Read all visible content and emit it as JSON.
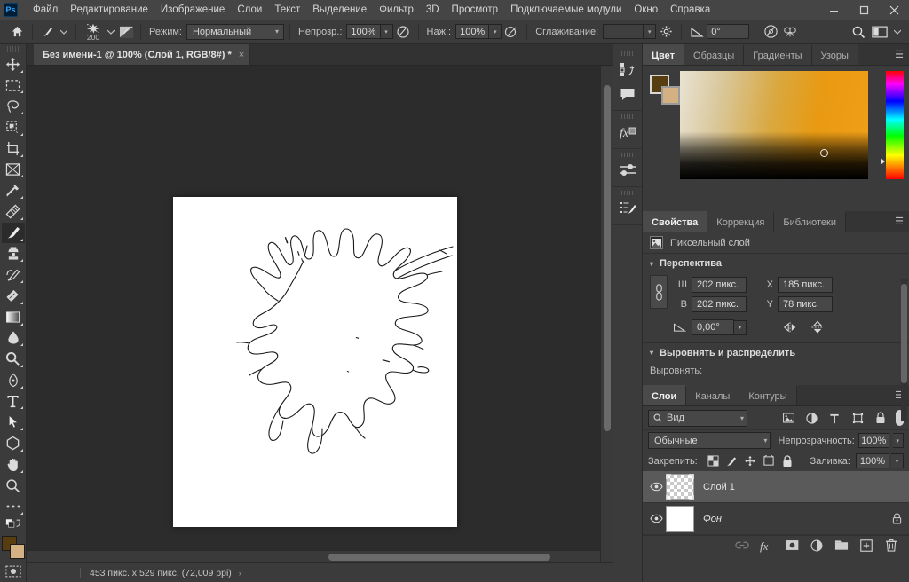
{
  "app": {
    "logo_text": "Ps",
    "window_controls": [
      "minimize",
      "maximize",
      "close"
    ]
  },
  "menubar": {
    "items": [
      {
        "label": "Файл",
        "name": "menu-file"
      },
      {
        "label": "Редактирование",
        "name": "menu-edit"
      },
      {
        "label": "Изображение",
        "name": "menu-image"
      },
      {
        "label": "Слои",
        "name": "menu-layers"
      },
      {
        "label": "Текст",
        "name": "menu-text"
      },
      {
        "label": "Выделение",
        "name": "menu-select"
      },
      {
        "label": "Фильтр",
        "name": "menu-filter"
      },
      {
        "label": "3D",
        "name": "menu-3d"
      },
      {
        "label": "Просмотр",
        "name": "menu-view"
      },
      {
        "label": "Подключаемые модули",
        "name": "menu-plugins"
      },
      {
        "label": "Окно",
        "name": "menu-window"
      },
      {
        "label": "Справка",
        "name": "menu-help"
      }
    ]
  },
  "options_bar": {
    "brush_size": "200",
    "mode_label": "Режим:",
    "mode_value": "Нормальный",
    "opacity_label": "Непрозр.:",
    "opacity_value": "100%",
    "flow_label": "Наж.:",
    "flow_value": "100%",
    "smoothing_label": "Сглаживание:",
    "angle_value": "0°"
  },
  "toolbar": {
    "tools": [
      {
        "name": "move-tool",
        "title": "Перемещение"
      },
      {
        "name": "marquee-tool",
        "title": "Прямоугольная область"
      },
      {
        "name": "lasso-tool",
        "title": "Лассо"
      },
      {
        "name": "quick-selection-tool",
        "title": "Быстрое выделение"
      },
      {
        "name": "crop-tool",
        "title": "Рамка"
      },
      {
        "name": "frame-tool",
        "title": "Кадр"
      },
      {
        "name": "eyedropper-tool",
        "title": "Пипетка"
      },
      {
        "name": "healing-brush-tool",
        "title": "Восстанавливающая кисть"
      },
      {
        "name": "brush-tool",
        "title": "Кисть",
        "active": true
      },
      {
        "name": "clone-stamp-tool",
        "title": "Штамп"
      },
      {
        "name": "history-brush-tool",
        "title": "Архивная кисть"
      },
      {
        "name": "eraser-tool",
        "title": "Ластик"
      },
      {
        "name": "gradient-tool",
        "title": "Градиент"
      },
      {
        "name": "blur-tool",
        "title": "Размытие"
      },
      {
        "name": "dodge-tool",
        "title": "Осветлитель"
      },
      {
        "name": "pen-tool",
        "title": "Перо"
      },
      {
        "name": "type-tool",
        "title": "Горизонтальный текст"
      },
      {
        "name": "path-selection-tool",
        "title": "Выделение контура"
      },
      {
        "name": "shape-tool",
        "title": "Многоугольник"
      },
      {
        "name": "hand-tool",
        "title": "Рука"
      },
      {
        "name": "zoom-tool",
        "title": "Масштаб"
      },
      {
        "name": "more-tools",
        "title": "Изменить панель инструментов"
      }
    ],
    "foreground_color": "#573d0f",
    "background_color": "#d3b183"
  },
  "document": {
    "tab_title": "Без имени-1 @ 100% (Слой 1, RGB/8#) *",
    "tab_close": "×"
  },
  "status_bar": {
    "zoom": "",
    "dimensions": "453 пикс. x 529 пикс. (72,009 ppi)",
    "arrow": "›"
  },
  "icon_dock": {
    "items": [
      {
        "name": "history-icon"
      },
      {
        "name": "comments-icon"
      },
      {
        "name": "layer-styles-fx-icon"
      },
      {
        "name": "adjustments-icon"
      },
      {
        "name": "brush-settings-icon"
      }
    ]
  },
  "color_panel": {
    "tabs": [
      {
        "label": "Цвет",
        "name": "tab-color",
        "active": true
      },
      {
        "label": "Образцы",
        "name": "tab-swatches",
        "active": false
      },
      {
        "label": "Градиенты",
        "name": "tab-gradients",
        "active": false
      },
      {
        "label": "Узоры",
        "name": "tab-patterns",
        "active": false
      }
    ],
    "menu_glyph": "☰",
    "foreground_color": "#573d0f",
    "background_color": "#d3b183"
  },
  "properties_panel": {
    "tabs": [
      {
        "label": "Свойства",
        "name": "tab-properties",
        "active": true
      },
      {
        "label": "Коррекция",
        "name": "tab-adjustments",
        "active": false
      },
      {
        "label": "Библиотеки",
        "name": "tab-libraries",
        "active": false
      }
    ],
    "menu_glyph": "☰",
    "layer_kind": "Пиксельный слой",
    "perspective_title": "Перспектива",
    "width_label": "Ш",
    "width_value": "202 пикс.",
    "height_label": "В",
    "height_value": "202 пикс.",
    "x_label": "X",
    "x_value": "185 пикс.",
    "y_label": "Y",
    "y_value": "78 пикс.",
    "angle_value": "0,00°",
    "align_title": "Выровнять и распределить",
    "align_label": "Выровнять:"
  },
  "layers_panel": {
    "tabs": [
      {
        "label": "Слои",
        "name": "tab-layers",
        "active": true
      },
      {
        "label": "Каналы",
        "name": "tab-channels",
        "active": false
      },
      {
        "label": "Контуры",
        "name": "tab-paths",
        "active": false
      }
    ],
    "menu_glyph": "☰",
    "filter_value": "Вид",
    "filter_icons": [
      {
        "name": "filter-pixel-icon"
      },
      {
        "name": "filter-adjustment-icon"
      },
      {
        "name": "filter-type-icon"
      },
      {
        "name": "filter-shape-icon"
      },
      {
        "name": "filter-smart-object-icon"
      }
    ],
    "blend_mode": "Обычные",
    "opacity_label": "Непрозрачность:",
    "opacity_value": "100%",
    "lock_label": "Закрепить:",
    "lock_icons": [
      {
        "name": "lock-transparency-icon"
      },
      {
        "name": "lock-image-icon"
      },
      {
        "name": "lock-position-icon"
      },
      {
        "name": "lock-artboard-icon"
      },
      {
        "name": "lock-all-icon"
      }
    ],
    "fill_label": "Заливка:",
    "fill_value": "100%",
    "layers": [
      {
        "name": "Слой 1",
        "selected": true,
        "thumb": "transparent",
        "locked": false
      },
      {
        "name": "Фон",
        "selected": false,
        "thumb": "white",
        "locked": true
      }
    ],
    "footer_icons": [
      {
        "name": "link-layers-icon"
      },
      {
        "name": "layer-style-fx-icon"
      },
      {
        "name": "layer-mask-icon"
      },
      {
        "name": "adjustment-layer-icon"
      },
      {
        "name": "new-group-icon"
      },
      {
        "name": "new-layer-icon"
      },
      {
        "name": "delete-layer-icon"
      }
    ]
  }
}
